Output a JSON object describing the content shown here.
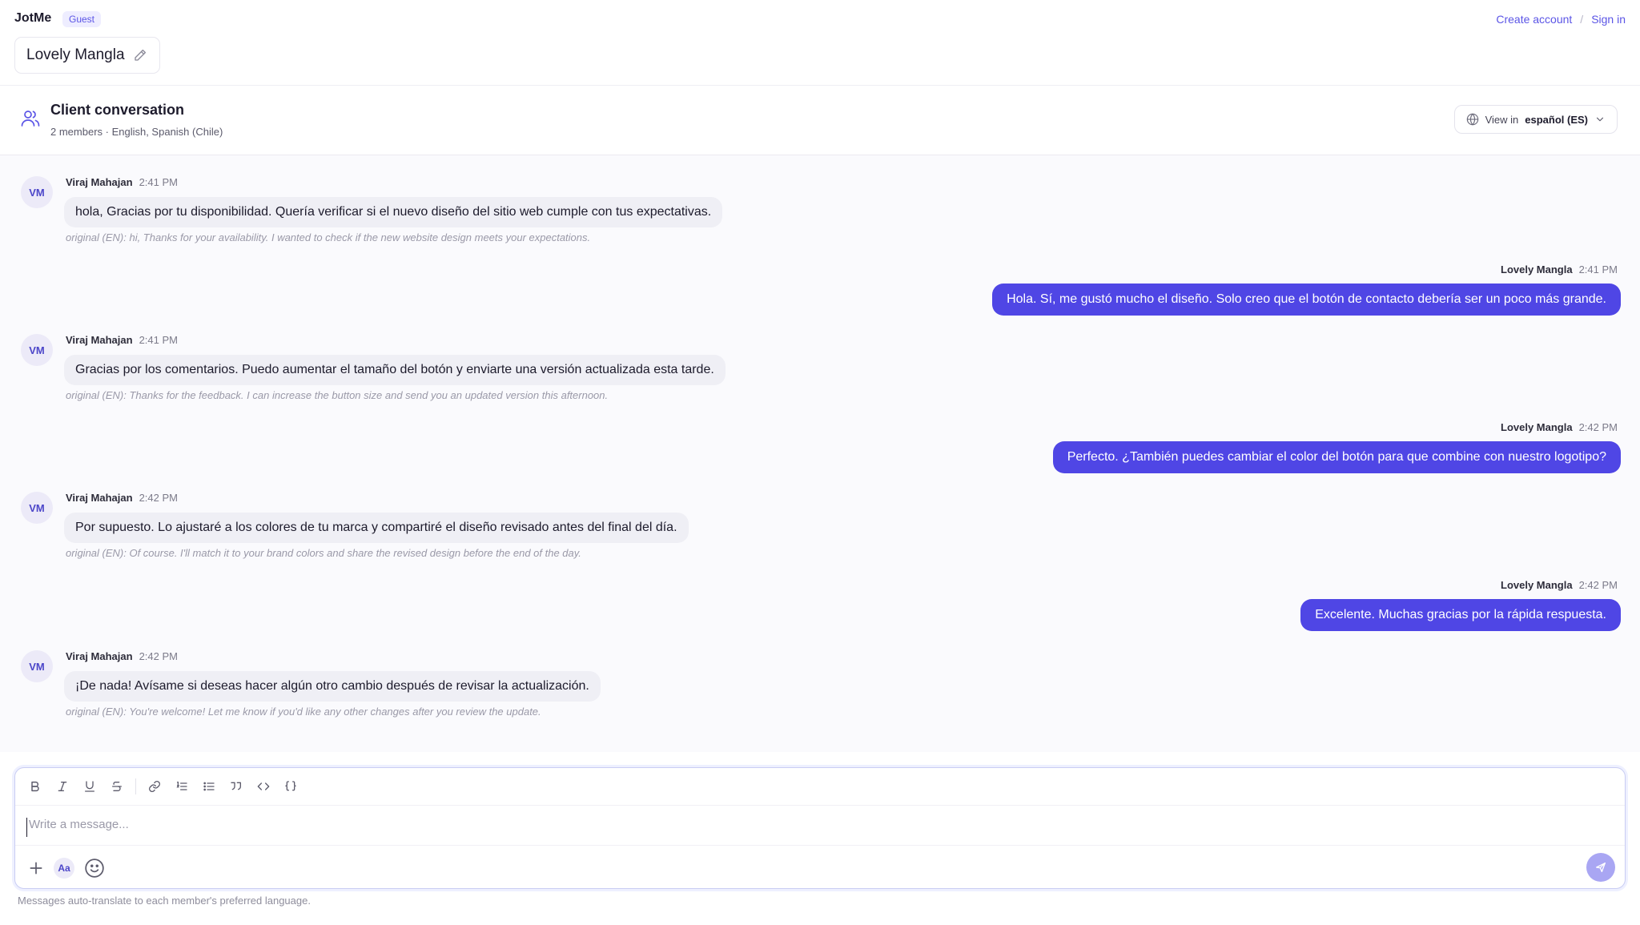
{
  "app": {
    "brand": "JotMe",
    "role_badge": "Guest",
    "create_account": "Create account",
    "separator": "/",
    "sign_in": "Sign in",
    "document_title": "Lovely Mangla"
  },
  "conversation": {
    "title": "Client conversation",
    "subtitle": "2 members · English, Spanish (Chile)",
    "view_in_label": "View in",
    "view_in_language": "español (ES)"
  },
  "messages": [
    {
      "direction": "in",
      "initials": "VM",
      "sender": "Viraj Mahajan",
      "time": "2:41 PM",
      "text": "hola, Gracias por tu disponibilidad. Quería verificar si el nuevo diseño del sitio web cumple con tus expectativas.",
      "original": "original (EN): hi, Thanks for your availability. I wanted to check if the new website design meets your expectations."
    },
    {
      "direction": "out",
      "sender": "Lovely Mangla",
      "time": "2:41 PM",
      "text": "Hola. Sí, me gustó mucho el diseño. Solo creo que el botón de contacto debería ser un poco más grande."
    },
    {
      "direction": "in",
      "initials": "VM",
      "sender": "Viraj Mahajan",
      "time": "2:41 PM",
      "text": "Gracias por los comentarios. Puedo aumentar el tamaño del botón y enviarte una versión actualizada esta tarde.",
      "original": "original (EN): Thanks for the feedback. I can increase the button size and send you an updated version this afternoon."
    },
    {
      "direction": "out",
      "sender": "Lovely Mangla",
      "time": "2:42 PM",
      "text": "Perfecto. ¿También puedes cambiar el color del botón para que combine con nuestro logotipo?"
    },
    {
      "direction": "in",
      "initials": "VM",
      "sender": "Viraj Mahajan",
      "time": "2:42 PM",
      "text": "Por supuesto. Lo ajustaré a los colores de tu marca y compartiré el diseño revisado antes del final del día.",
      "original": "original (EN): Of course. I'll match it to your brand colors and share the revised design before the end of the day."
    },
    {
      "direction": "out",
      "sender": "Lovely Mangla",
      "time": "2:42 PM",
      "text": "Excelente. Muchas gracias por la rápida respuesta."
    },
    {
      "direction": "in",
      "initials": "VM",
      "sender": "Viraj Mahajan",
      "time": "2:42 PM",
      "text": "¡De nada! Avísame si deseas hacer algún otro cambio después de revisar la actualización.",
      "original": "original (EN): You're welcome! Let me know if you'd like any other changes after you review the update."
    }
  ],
  "composer": {
    "placeholder": "Write a message...",
    "format_button_label": "Aa",
    "toolbar_icons": [
      "bold-icon",
      "italic-icon",
      "underline-icon",
      "strikethrough-icon",
      "link-icon",
      "ordered-list-icon",
      "bullet-list-icon",
      "quote-icon",
      "code-icon",
      "code-block-icon"
    ],
    "footer_note": "Messages auto-translate to each member's preferred language."
  },
  "colors": {
    "accent": "#4f46e5",
    "accent_light": "#eeedff",
    "incoming_bubble": "#efeff5",
    "send_disabled": "#a9a6f3"
  }
}
